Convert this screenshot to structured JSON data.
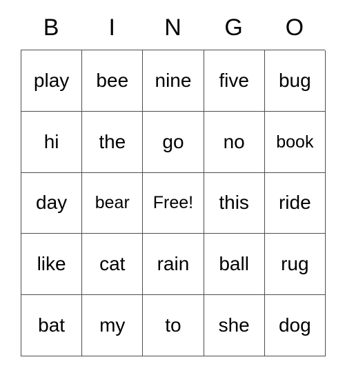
{
  "card": {
    "header_letters": [
      "B",
      "I",
      "N",
      "G",
      "O"
    ],
    "rows": [
      [
        "play",
        "bee",
        "nine",
        "five",
        "bug"
      ],
      [
        "hi",
        "the",
        "go",
        "no",
        "book"
      ],
      [
        "day",
        "bear",
        "Free!",
        "this",
        "ride"
      ],
      [
        "like",
        "cat",
        "rain",
        "ball",
        "rug"
      ],
      [
        "bat",
        "my",
        "to",
        "she",
        "dog"
      ]
    ],
    "free_space": {
      "row": 2,
      "col": 2,
      "label": "Free!"
    },
    "colors": {
      "background": "#ffffff",
      "text": "#000000",
      "grid_line": "#4d4d4d"
    }
  }
}
